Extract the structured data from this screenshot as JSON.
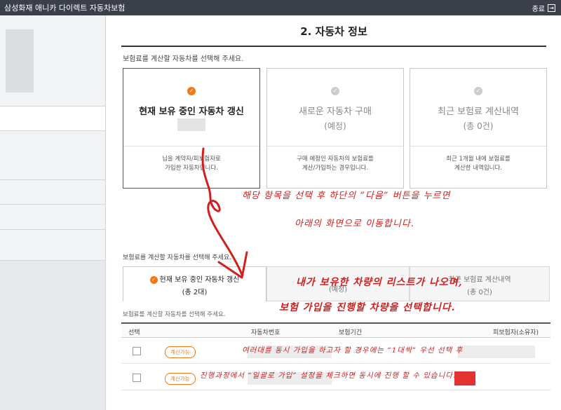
{
  "window": {
    "title": "삼성화재 애니카 다이렉트 자동차보험",
    "close_label": "종료",
    "close_glyph": "⇥"
  },
  "page": {
    "title": "2. 자동차 정보",
    "instruction": "보험료를 계산할 자동차를 선택해 주세요."
  },
  "cards": [
    {
      "check": "✓",
      "title": "현재 보유 중인 자동차 갱신",
      "sub": "",
      "desc1": "님을 계약자/피보험자로",
      "desc2": "가입한 자동차입니다."
    },
    {
      "check": "✓",
      "title": "새로운 자동차 구매",
      "sub": "(예정)",
      "desc1": "구매 예정인 자동차의 보험료를",
      "desc2": "계산/가입하는 경우입니다."
    },
    {
      "check": "✓",
      "title": "최근 보험료 계산내역",
      "sub": "(총 0건)",
      "desc1": "최근 1개월 내에 보험료를",
      "desc2": "계산한 내역입니다."
    }
  ],
  "annotations": {
    "line1": "해당 항목을 선택 후 하단의 “다음” 버튼을 누르면",
    "line2": "아래의 화면으로 이동합니다.",
    "line3": "내가 보유한 차량의 리스트가 나오며,",
    "line4": "보험 가입을 진행할 차량을 선택합니다.",
    "line5": "여러대를 동시 가입을 하고자 할 경우에는 “1대씩” 우선 선택 후",
    "line6": "진행과정에서 “일괄로 가입” 설정을 체크하면 동시에 진행 할 수 있습니다."
  },
  "lower": {
    "instruction": "보험료를 계산할 자동차를 선택해 주세요.",
    "tab_active_check": "✓",
    "tab_active_title": "현재 보유 중인 자동차 갱신",
    "tab_active_sub": "(총 2대)",
    "tab2_sub": "(예정)",
    "tab3_title": "최근 보험료 계산내역",
    "tab3_sub": "(총 0건)",
    "list_instruction": "보험료를 계산할 자동차를 선택해 주세요.",
    "columns": [
      "선택",
      "자동차번호",
      "보험기간",
      "피보험자(소유자)"
    ],
    "rows": [
      {
        "badge": "계산가능"
      },
      {
        "badge": "계산가능"
      }
    ]
  },
  "colors": {
    "accent": "#f07818",
    "annotation": "#d31e1e",
    "titlebar": "#3a3f4a"
  }
}
